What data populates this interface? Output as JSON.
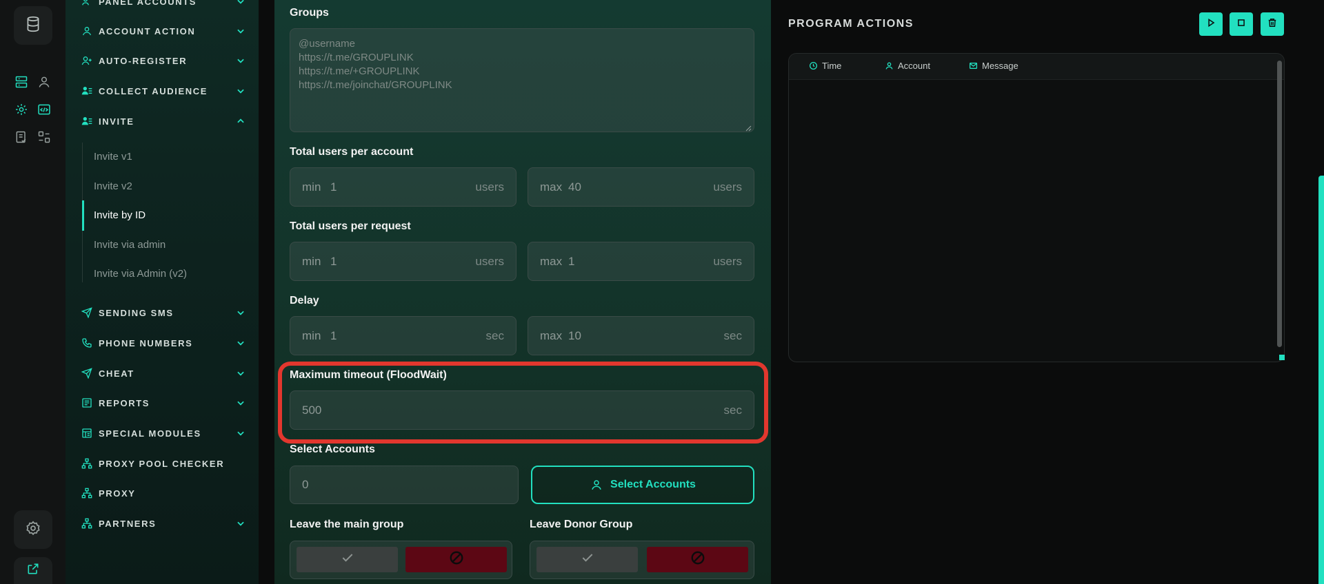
{
  "theme": {
    "accent": "#22e0c0",
    "danger": "#e2372e",
    "stop_red": "#5c0714"
  },
  "rail": {
    "icons": [
      "database-icon",
      "server-list-icon",
      "user-pin-icon",
      "gear-icon",
      "code-window-icon",
      "checklist-icon",
      "modules-icon",
      "settings-icon",
      "external-link-icon"
    ]
  },
  "sidebar": {
    "items": [
      {
        "label": "PANEL ACCOUNTS",
        "icon": "users-icon"
      },
      {
        "label": "ACCOUNT ACTION",
        "icon": "user-icon"
      },
      {
        "label": "AUTO-REGISTER",
        "icon": "user-plus-icon"
      },
      {
        "label": "COLLECT AUDIENCE",
        "icon": "user-list-icon"
      },
      {
        "label": "INVITE",
        "icon": "user-list-icon"
      },
      {
        "label": "SENDING SMS",
        "icon": "send-icon"
      },
      {
        "label": "PHONE NUMBERS",
        "icon": "phone-icon"
      },
      {
        "label": "CHEAT",
        "icon": "send-icon"
      },
      {
        "label": "REPORTS",
        "icon": "report-icon"
      },
      {
        "label": "SPECIAL MODULES",
        "icon": "module-icon"
      },
      {
        "label": "PROXY POOL CHECKER",
        "icon": "network-icon"
      },
      {
        "label": "PROXY",
        "icon": "network-icon"
      },
      {
        "label": "PARTNERS",
        "icon": "network-icon"
      }
    ],
    "invite_sub": [
      "Invite v1",
      "Invite v2",
      "Invite by ID",
      "Invite via admin",
      "Invite via Admin (v2)"
    ]
  },
  "form": {
    "groups": {
      "label": "Groups",
      "placeholder_lines": [
        "@username",
        "https://t.me/GROUPLINK",
        "https://t.me/+GROUPLINK",
        "https://t.me/joinchat/GROUPLINK"
      ]
    },
    "users_per_account": {
      "label": "Total users per account",
      "min_prefix": "min",
      "min": "1",
      "max_prefix": "max",
      "max": "40",
      "unit": "users"
    },
    "users_per_request": {
      "label": "Total users per request",
      "min_prefix": "min",
      "min": "1",
      "max_prefix": "max",
      "max": "1",
      "unit": "users"
    },
    "delay": {
      "label": "Delay",
      "min_prefix": "min",
      "min": "1",
      "max_prefix": "max",
      "max": "10",
      "unit": "sec"
    },
    "floodwait": {
      "label": "Maximum timeout (FloodWait)",
      "value": "500",
      "unit": "sec"
    },
    "select_accounts": {
      "label": "Select Accounts",
      "count": "0",
      "button": "Select Accounts"
    },
    "leave_main": {
      "label": "Leave the main group"
    },
    "leave_donor": {
      "label": "Leave Donor Group"
    }
  },
  "program_actions": {
    "title": "PROGRAM ACTIONS",
    "columns": [
      {
        "label": "Time",
        "icon": "clock-icon"
      },
      {
        "label": "Account",
        "icon": "user-icon"
      },
      {
        "label": "Message",
        "icon": "mail-icon"
      }
    ]
  }
}
